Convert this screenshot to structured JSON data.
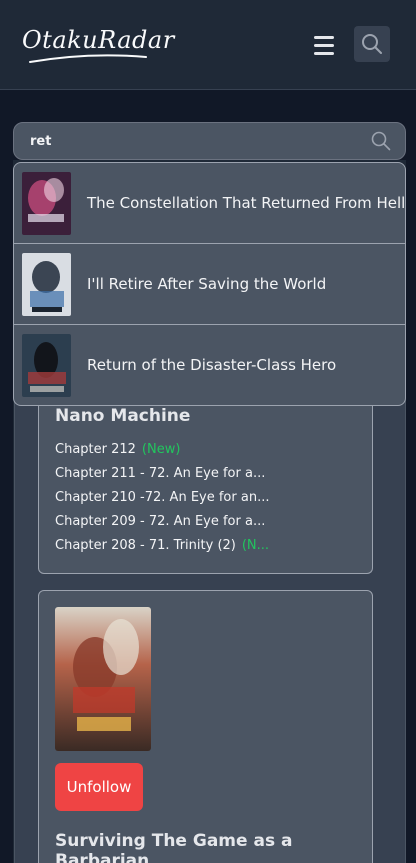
{
  "header": {
    "logo_text": "OtakuRadar"
  },
  "search": {
    "value": "ret",
    "placeholder": ""
  },
  "dropdown": {
    "results": [
      {
        "title": "The Constellation That Returned From Hell"
      },
      {
        "title": "I'll Retire After Saving the World"
      },
      {
        "title": "Return of the Disaster-Class Hero"
      }
    ]
  },
  "cards": [
    {
      "title": "Nano Machine",
      "chapters": [
        {
          "label": "Chapter 212",
          "badge": "(New)"
        },
        {
          "label": "Chapter 211 - 72. An Eye for a...",
          "badge": ""
        },
        {
          "label": "Chapter 210 -72. An Eye for an...",
          "badge": ""
        },
        {
          "label": "Chapter 209 - 72. An Eye for a...",
          "badge": ""
        },
        {
          "label": "Chapter 208 - 71. Trinity (2)",
          "badge": "(N..."
        }
      ]
    },
    {
      "title": "Surviving The Game as a Barbarian",
      "unfollow_label": "Unfollow"
    }
  ],
  "colors": {
    "new_badge": "#22c55e",
    "unfollow": "#ef4444"
  }
}
